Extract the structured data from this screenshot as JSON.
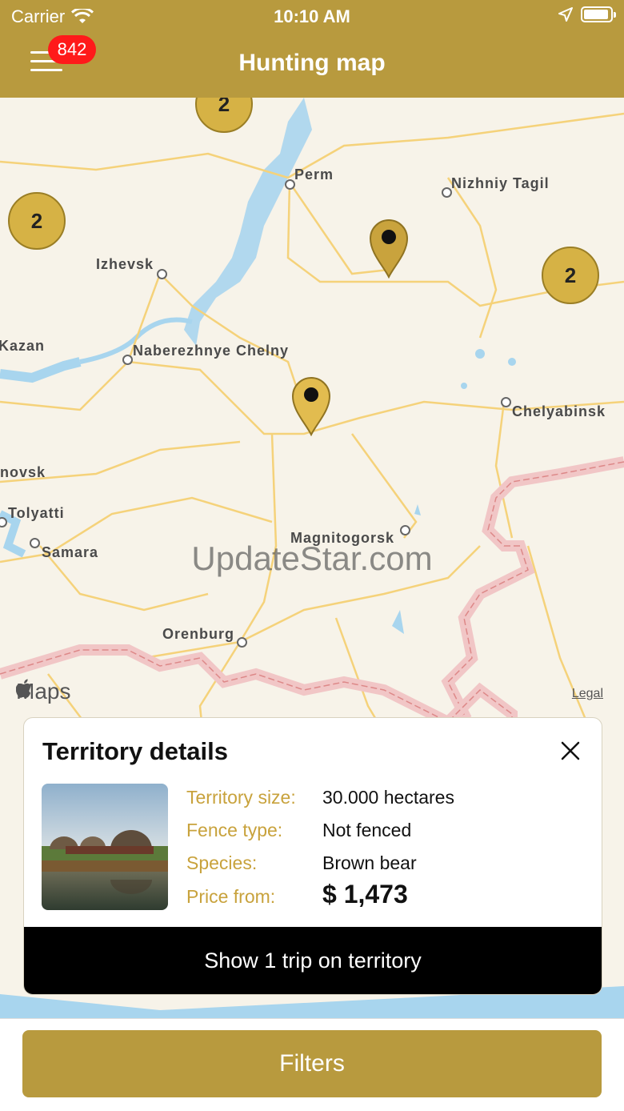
{
  "status_bar": {
    "carrier": "Carrier",
    "time": "10:10 AM"
  },
  "nav": {
    "badge_count": "842",
    "title": "Hunting map"
  },
  "map": {
    "cities": [
      {
        "name": "Perm"
      },
      {
        "name": "Nizhniy Tagil"
      },
      {
        "name": "Izhevsk"
      },
      {
        "name": "Kazan"
      },
      {
        "name": "Naberezhnye Chelny"
      },
      {
        "name": "Chelyabinsk"
      },
      {
        "name": "novsk"
      },
      {
        "name": "Tolyatti"
      },
      {
        "name": "Samara"
      },
      {
        "name": "Magnitogorsk"
      },
      {
        "name": "Orenburg"
      }
    ],
    "clusters": [
      "2",
      "2",
      "2"
    ],
    "watermark": "UpdateStar.com",
    "maps_label": "Maps",
    "legal": "Legal"
  },
  "territory": {
    "title": "Territory details",
    "size_label": "Territory size:",
    "size_value": "30.000 hectares",
    "fence_label": "Fence type:",
    "fence_value": "Not fenced",
    "species_label": "Species:",
    "species_value": "Brown bear",
    "price_label": "Price from:",
    "price_value": "$ 1,473",
    "show_button": "Show 1 trip on territory"
  },
  "bottom": {
    "filters_label": "Filters"
  },
  "colors": {
    "brand": "#b89a3e",
    "label_gold": "#c8a23c",
    "badge_red": "#ff1a1a",
    "cluster_fill": "#d6b245"
  }
}
